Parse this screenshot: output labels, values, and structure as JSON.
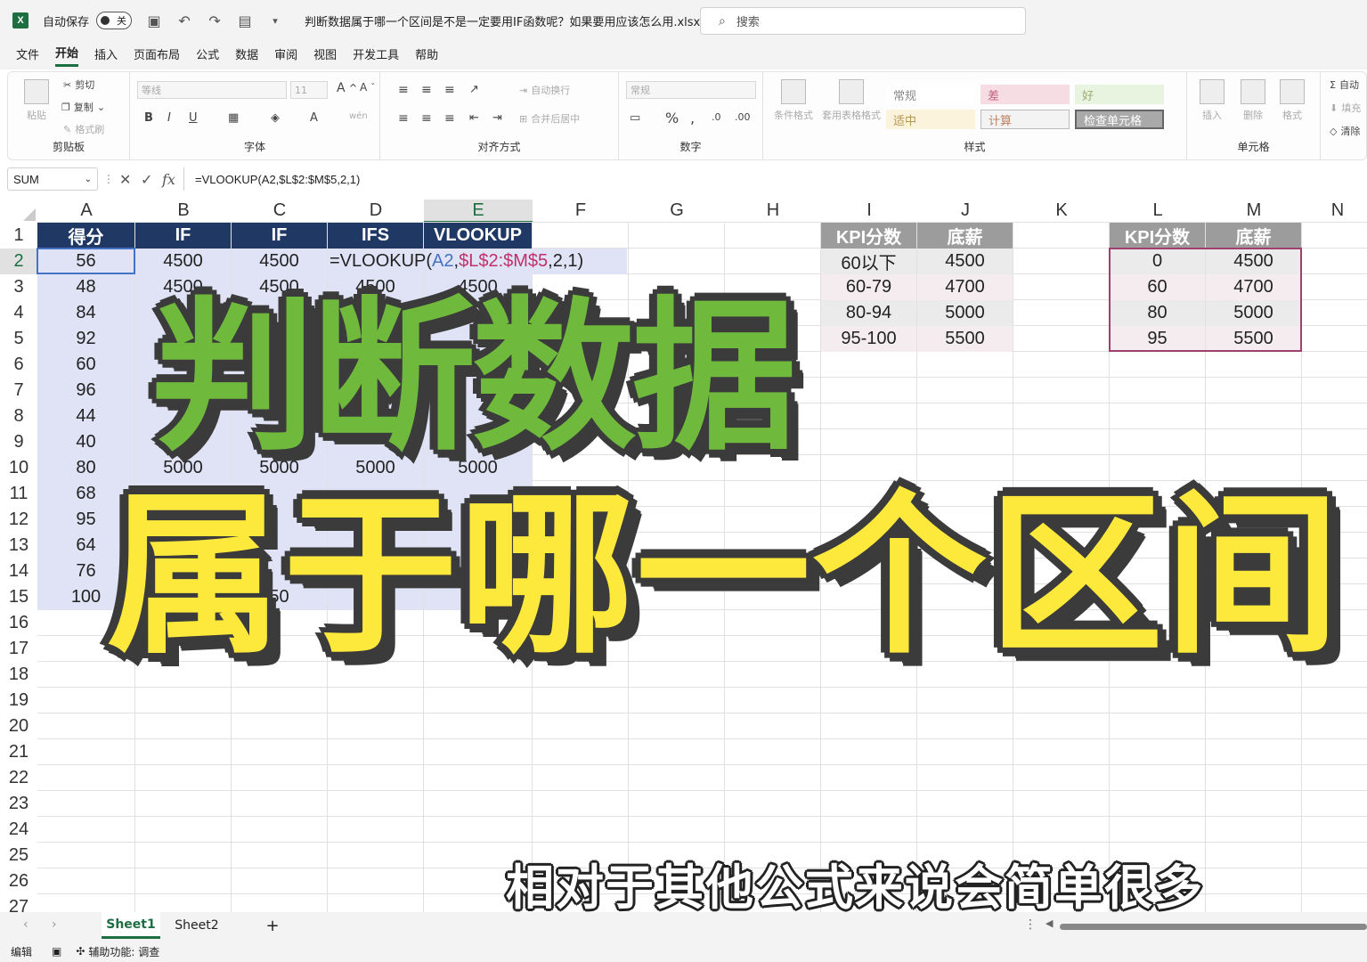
{
  "titlebar": {
    "autosave_label": "自动保存",
    "toggle_state": "关",
    "filename": "判断数据属于哪一个区间是不是一定要用IF函数呢？如果要用应该怎么用.xlsx ⌄",
    "search_placeholder": "搜索"
  },
  "menu": [
    "文件",
    "开始",
    "插入",
    "页面布局",
    "公式",
    "数据",
    "审阅",
    "视图",
    "开发工具",
    "帮助"
  ],
  "ribbon": {
    "clipboard": {
      "label": "剪贴板",
      "paste": "粘贴",
      "cut": "剪切",
      "copy": "复制",
      "format_painter": "格式刷"
    },
    "font": {
      "label": "字体",
      "font_name": "等线",
      "font_size": "11"
    },
    "alignment": {
      "label": "对齐方式",
      "wrap": "自动换行",
      "merge": "合并后居中"
    },
    "number": {
      "label": "数字",
      "format": "常规"
    },
    "styles": {
      "label": "样式",
      "conditional": "条件格式",
      "table_format": "套用表格格式",
      "normal": "常规",
      "bad": "差",
      "good": "好",
      "neutral": "适中",
      "calculation": "计算",
      "check_cell": "检查单元格"
    },
    "cells": {
      "label": "单元格",
      "insert": "插入",
      "delete": "删除",
      "format": "格式"
    },
    "editing": {
      "autosum": "自动",
      "fill": "填充",
      "clear": "清除"
    }
  },
  "formula_bar": {
    "name_box": "SUM",
    "formula": "=VLOOKUP(A2,$L$2:$M$5,2,1)"
  },
  "columns": [
    "A",
    "B",
    "C",
    "D",
    "E",
    "F",
    "G",
    "H",
    "I",
    "J",
    "K",
    "L",
    "M",
    "N"
  ],
  "rows": [
    "1",
    "2",
    "3",
    "4",
    "5",
    "6",
    "7",
    "8",
    "9",
    "10",
    "11",
    "12",
    "13",
    "14",
    "15",
    "16",
    "17",
    "18",
    "19",
    "20",
    "21",
    "22",
    "23",
    "24",
    "25",
    "26",
    "27"
  ],
  "table_main": {
    "headers": [
      "得分",
      "IF",
      "IF",
      "IFS",
      "VLOOKUP"
    ],
    "scores": [
      "56",
      "48",
      "84",
      "92",
      "60",
      "96",
      "44",
      "40",
      "80",
      "68",
      "95",
      "64",
      "76",
      "100"
    ],
    "row2": [
      "4500",
      "4500"
    ],
    "row3": [
      "4500",
      "4500",
      "4500",
      "4500"
    ],
    "row10": [
      "5000",
      "5000",
      "5000",
      "5000"
    ],
    "row15": [
      "50",
      "00"
    ],
    "edit_prefix": "=VLOOKUP(",
    "edit_ref1": "A2",
    "edit_sep": ",",
    "edit_ref2": "$L$2:$M$5",
    "edit_suffix": ",2,1)"
  },
  "table_kpi_text": {
    "headers": [
      "KPI分数",
      "底薪"
    ],
    "rows": [
      [
        "60以下",
        "4500"
      ],
      [
        "60-79",
        "4700"
      ],
      [
        "80-94",
        "5000"
      ],
      [
        "95-100",
        "5500"
      ]
    ]
  },
  "table_kpi_num": {
    "headers": [
      "KPI分数",
      "底薪"
    ],
    "rows": [
      [
        "0",
        "4500"
      ],
      [
        "60",
        "4700"
      ],
      [
        "80",
        "5000"
      ],
      [
        "95",
        "5500"
      ]
    ]
  },
  "sheets": [
    "Sheet1",
    "Sheet2"
  ],
  "add_sheet": "+",
  "status": {
    "mode": "编辑",
    "accessibility": "辅助功能: 调查"
  },
  "overlay": {
    "line1": "判断数据",
    "line2": "属于哪一个区间",
    "subtitle": "相对于其他公式来说会简单很多"
  },
  "colors": {
    "header_navy": "#1f3864",
    "header_gray": "#9c9c9c",
    "accent_green": "#1d6f42",
    "overlay_green": "#6fba3c",
    "overlay_yellow": "#fde93c"
  }
}
